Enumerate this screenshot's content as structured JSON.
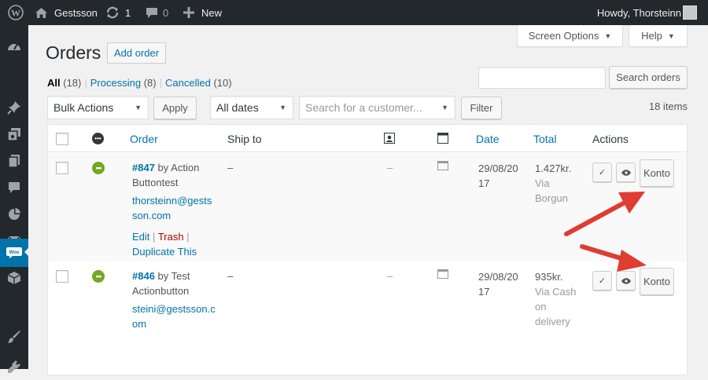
{
  "adminbar": {
    "site_name": "Gestsson",
    "updates_count": "1",
    "comments_count": "0",
    "new_label": "New",
    "howdy": "Howdy, Thorsteinn"
  },
  "menu_icons": [
    "dashboard-icon",
    "posts-icon",
    "media-icon",
    "pages-icon",
    "comments-icon",
    "feedback-icon",
    "woocommerce-icon",
    "products-icon",
    "appearance-icon",
    "plugins-icon"
  ],
  "screen_meta": {
    "screen_options": "Screen Options",
    "help": "Help"
  },
  "page": {
    "title": "Orders",
    "add_order": "Add order"
  },
  "views": {
    "all_label": "All",
    "all_count": "(18)",
    "processing_label": "Processing",
    "processing_count": "(8)",
    "cancelled_label": "Cancelled",
    "cancelled_count": "(10)"
  },
  "search": {
    "value": "",
    "button": "Search orders"
  },
  "filters": {
    "bulk_actions": "Bulk Actions",
    "apply": "Apply",
    "dates": "All dates",
    "customer_placeholder": "Search for a customer...",
    "filter": "Filter",
    "items_count": "18 items"
  },
  "columns": {
    "order": "Order",
    "ship_to": "Ship to",
    "date": "Date",
    "total": "Total",
    "actions": "Actions"
  },
  "orders": [
    {
      "number": "#847",
      "by_text": "by Action",
      "name_line2": "Buttontest",
      "email_line1": "thorsteinn@gests",
      "email_line2": "son.com",
      "ship_to": "–",
      "dash2": "–",
      "date_line1": "29/08/20",
      "date_line2": "17",
      "total": "1.427kr.",
      "via_line1": "Via",
      "via_line2": "Borgun",
      "via_line3": "",
      "edit": "Edit",
      "trash": "Trash",
      "duplicate": "Duplicate This",
      "complete_icon": "✓",
      "view_icon": "eye-icon",
      "konto": "Konto"
    },
    {
      "number": "#846",
      "by_text": "by Test",
      "name_line2": "Actionbutton",
      "email_line1": "steini@gestsson.c",
      "email_line2": "om",
      "ship_to": "–",
      "dash2": "–",
      "date_line1": "29/08/20",
      "date_line2": "17",
      "total": "935kr.",
      "via_line1": "Via Cash",
      "via_line2": "on",
      "via_line3": "delivery",
      "complete_icon": "✓",
      "view_icon": "eye-icon",
      "konto": "Konto"
    }
  ],
  "colors": {
    "admin_bar": "#23282d",
    "accent": "#0073aa",
    "status_processing": "#73a724",
    "arrow": "#e03c31",
    "trash": "#aa0000"
  }
}
